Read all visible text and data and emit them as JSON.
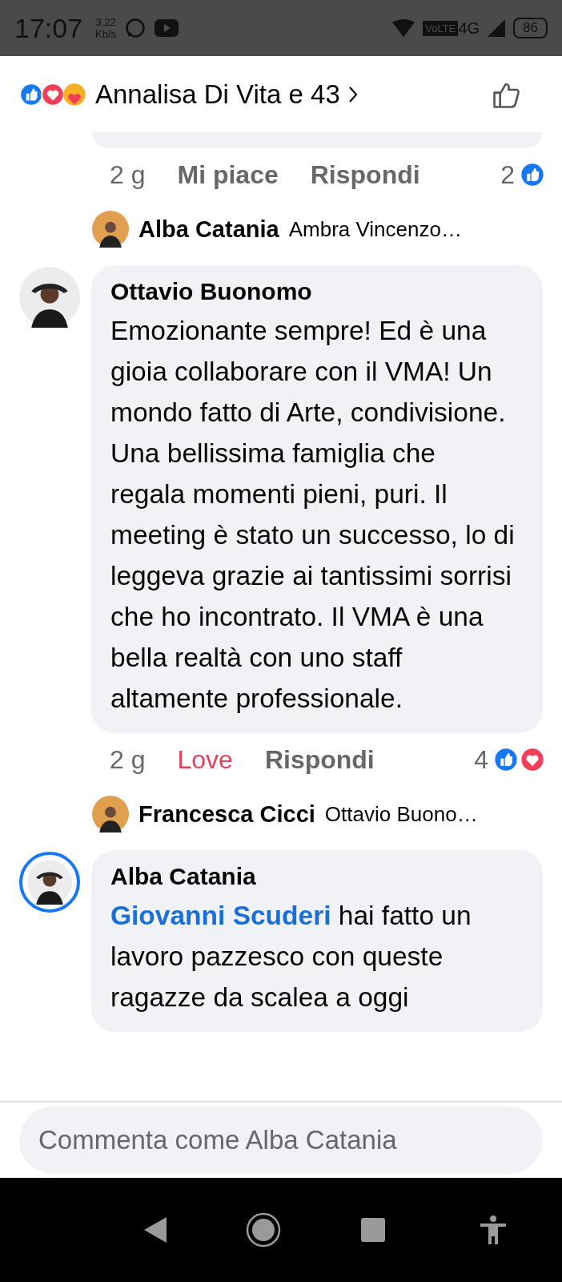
{
  "status_bar": {
    "time": "17:07",
    "speed": "3,22",
    "speed_unit": "Kb/s",
    "network": "4G",
    "volte": "VoLTE",
    "battery": "86"
  },
  "header": {
    "reaction_icons": [
      {
        "kind": "like"
      },
      {
        "kind": "love"
      },
      {
        "kind": "care"
      }
    ],
    "title": "Annalisa Di Vita e 43"
  },
  "items": [
    {
      "kind": "actions",
      "time": "2 g",
      "react_label": "Mi piace",
      "reacted": false,
      "reply": "Rispondi",
      "count": "2",
      "reaction_icons": [
        {
          "kind": "like"
        }
      ]
    },
    {
      "kind": "reply_preview",
      "name": "Alba Catania",
      "text": "Ambra Vincenzo…"
    },
    {
      "kind": "comment",
      "name": "Ottavio Buonomo",
      "story_ring": false,
      "text": "Emozionante sempre! Ed è una gioia collaborare con il VMA! Un mondo fatto di Arte, condivisione. Una bellissima famiglia che regala momenti pieni, puri. Il meeting è stato un successo, lo di leggeva grazie ai tantissimi sorrisi che ho incontrato. Il VMA è una bella realtà con uno staff altamente professionale."
    },
    {
      "kind": "actions",
      "time": "2 g",
      "react_label": "Love",
      "reacted": true,
      "reply": "Rispondi",
      "count": "4",
      "reaction_icons": [
        {
          "kind": "like"
        },
        {
          "kind": "love"
        }
      ]
    },
    {
      "kind": "reply_preview",
      "name": "Francesca Cicci",
      "text": "Ottavio Buono…"
    },
    {
      "kind": "comment",
      "name": "Alba Catania",
      "story_ring": true,
      "mention": "Giovanni Scuderi",
      "text": "hai fatto un lavoro pazzesco con queste ragazze da scalea a oggi"
    }
  ],
  "composer": {
    "placeholder": "Commenta come Alba Catania"
  }
}
